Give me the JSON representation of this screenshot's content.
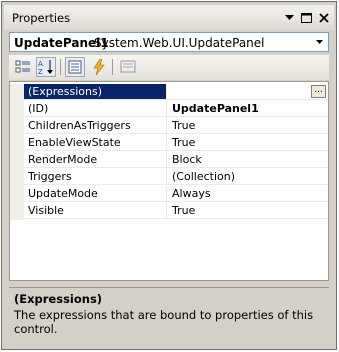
{
  "window": {
    "title": "Properties",
    "icons": [
      "pin-dropdown-icon",
      "maximize-icon",
      "close-icon"
    ]
  },
  "object_selector": {
    "name": "UpdatePanel1",
    "type": "System.Web.UI.UpdatePanel"
  },
  "toolbar": {
    "buttons": [
      "categorized-icon",
      "alphabetical-icon",
      "properties-icon",
      "events-icon",
      "property-pages-icon"
    ]
  },
  "properties": [
    {
      "name": "(Expressions)",
      "value": ""
    },
    {
      "name": "(ID)",
      "value": "UpdatePanel1"
    },
    {
      "name": "ChildrenAsTriggers",
      "value": "True"
    },
    {
      "name": "EnableViewState",
      "value": "True"
    },
    {
      "name": "RenderMode",
      "value": "Block"
    },
    {
      "name": "Triggers",
      "value": "(Collection)"
    },
    {
      "name": "UpdateMode",
      "value": "Always"
    },
    {
      "name": "Visible",
      "value": "True"
    }
  ],
  "ellipsis_label": "...",
  "description": {
    "title": "(Expressions)",
    "text": "The expressions that are bound to properties of this control."
  },
  "colors": {
    "selection": "#0a246a",
    "panel": "#d4d0c8"
  }
}
